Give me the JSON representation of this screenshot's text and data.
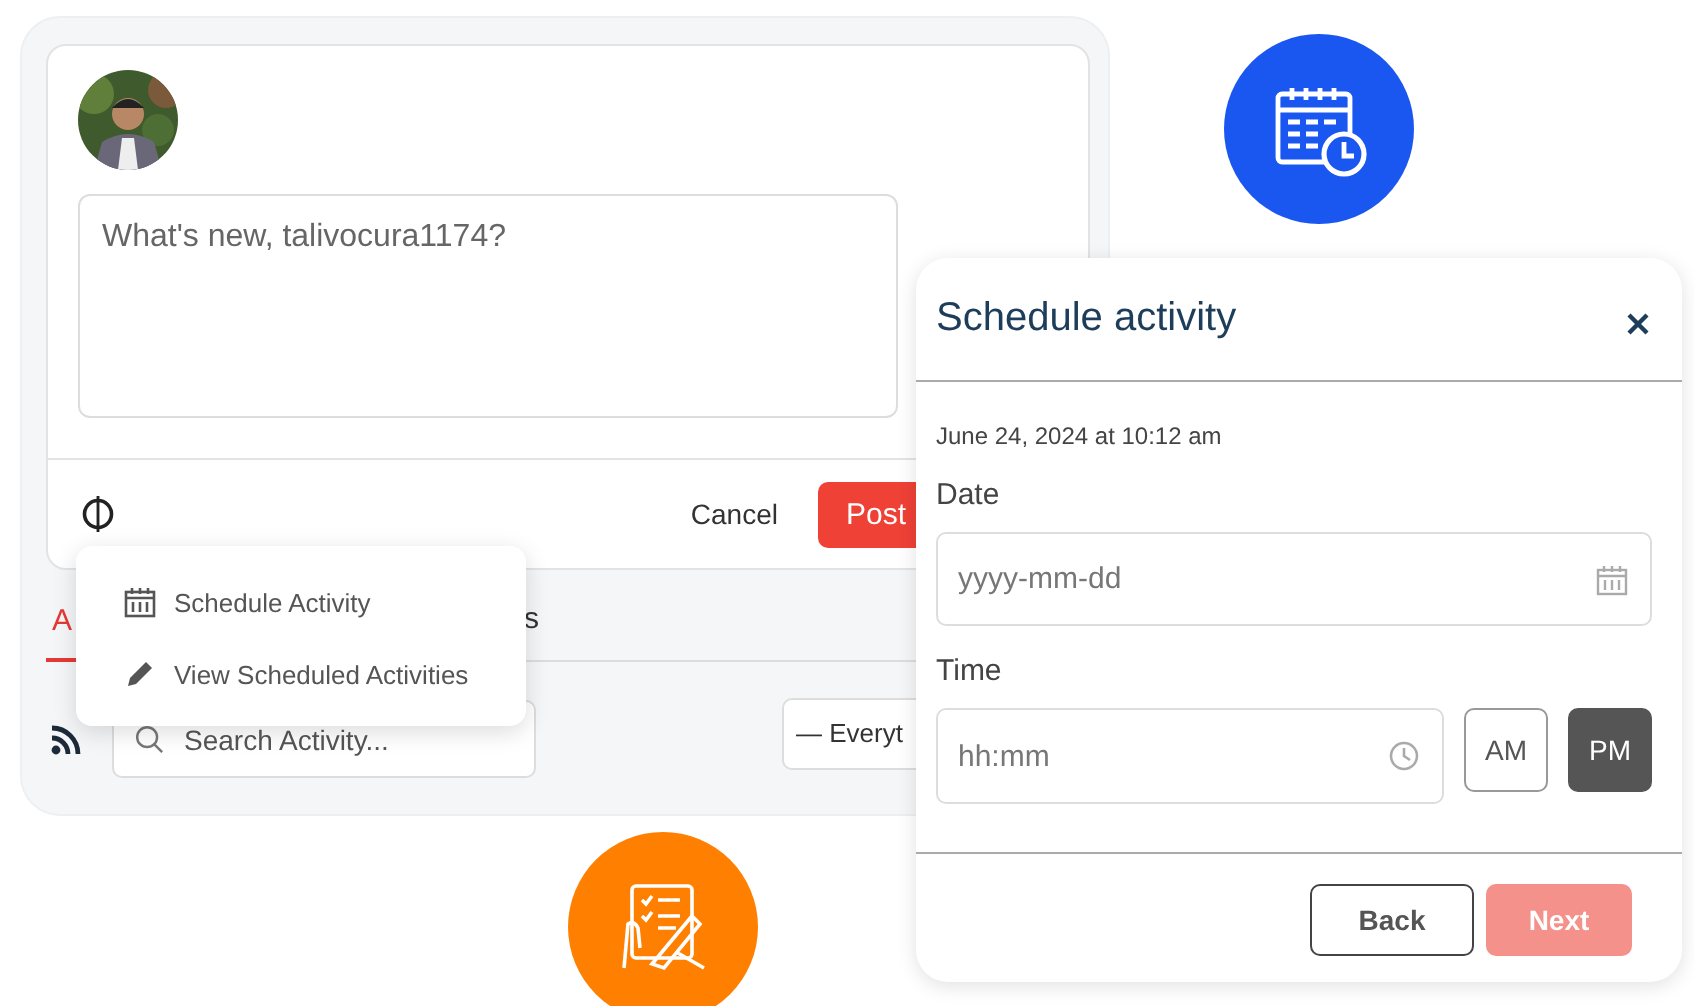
{
  "composer": {
    "placeholder": "What's new, talivocura1174?",
    "cancel": "Cancel",
    "post": "Post"
  },
  "menu": {
    "items": [
      {
        "kind": "schedule",
        "label": "Schedule Activity"
      },
      {
        "kind": "view",
        "label": "View Scheduled Activities"
      }
    ]
  },
  "tabs": [
    {
      "label": "A",
      "selected": true
    },
    {
      "label": "s",
      "selected": false
    }
  ],
  "search": {
    "placeholder": "Search Activity..."
  },
  "filter": {
    "value": "— Everyt"
  },
  "modal": {
    "title": "Schedule activity",
    "timestamp": "June 24, 2024 at 10:12 am",
    "date": {
      "label": "Date",
      "placeholder": "yyyy-mm-dd"
    },
    "time": {
      "label": "Time",
      "placeholder": "hh:mm"
    },
    "meridiem": [
      {
        "label": "AM",
        "selected": false
      },
      {
        "label": "PM",
        "selected": true
      }
    ],
    "back": "Back",
    "next": {
      "label": "Next",
      "disabled": true
    }
  }
}
